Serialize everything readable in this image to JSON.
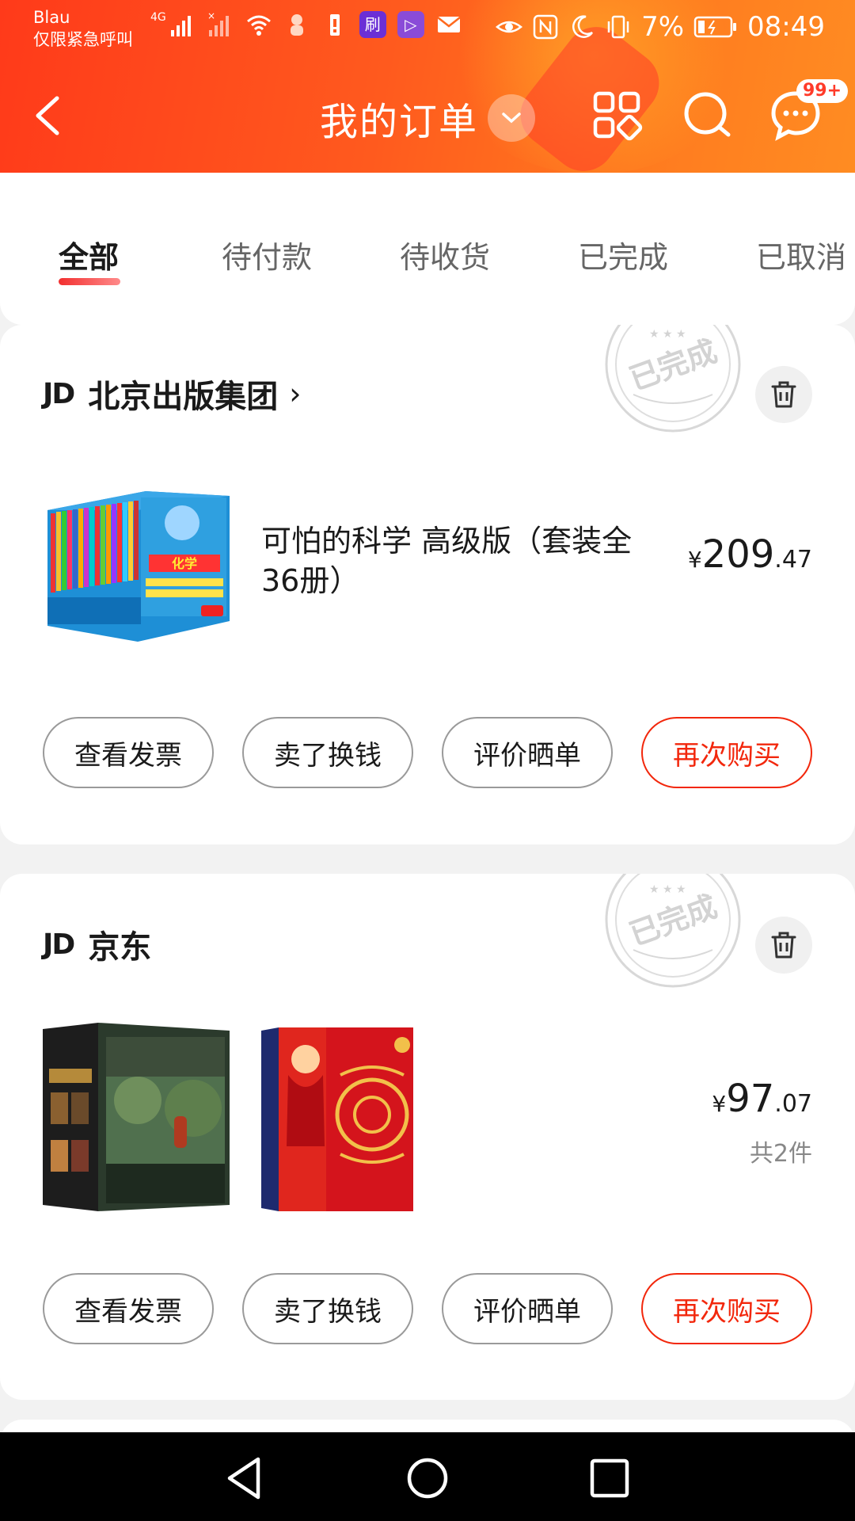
{
  "status_bar": {
    "carrier_line1": "Blau",
    "carrier_line2": "仅限紧急呼叫",
    "network_label": "4G",
    "battery_text": "7%",
    "time": "08:49",
    "icons": [
      "signal-icon",
      "wifi-icon",
      "battery-icon",
      "eye-icon",
      "nfc-icon",
      "moon-icon",
      "vibrate-icon",
      "mail-icon"
    ]
  },
  "header": {
    "title": "我的订单",
    "message_badge": "99+"
  },
  "tabs": [
    {
      "label": "全部",
      "active": true
    },
    {
      "label": "待付款",
      "active": false
    },
    {
      "label": "待收货",
      "active": false
    },
    {
      "label": "已完成",
      "active": false
    },
    {
      "label": "已取消",
      "active": false
    }
  ],
  "orders": [
    {
      "shop_logo": "JD",
      "shop_name": "北京出版集团",
      "shop_arrow": "›",
      "stamp_text": "已完成",
      "goods_title": "可怕的科学 高级版（套装全36册）",
      "price_currency": "¥",
      "price_int": "209",
      "price_dec": ".47",
      "buttons": [
        "查看发票",
        "卖了换钱",
        "评价晒单",
        "再次购买"
      ]
    },
    {
      "shop_logo": "JD",
      "shop_name": "京东",
      "stamp_text": "已完成",
      "price_currency": "¥",
      "price_int": "97",
      "price_dec": ".07",
      "item_count": "共2件",
      "buttons": [
        "查看发票",
        "卖了换钱",
        "评价晒单",
        "再次购买"
      ]
    }
  ],
  "colors": {
    "brand_red": "#f2270c",
    "header_start": "#ff3a1a",
    "header_end": "#ff8c22"
  }
}
